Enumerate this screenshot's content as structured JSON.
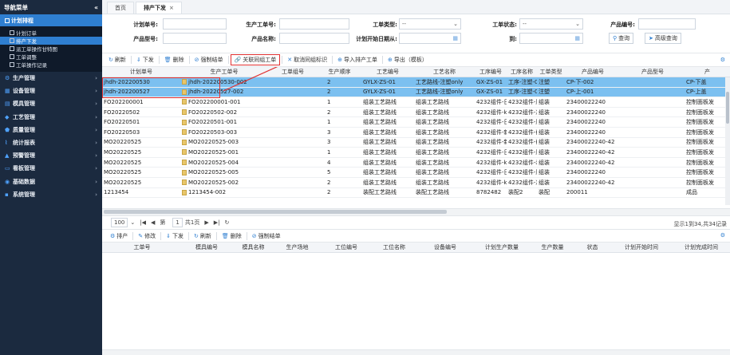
{
  "sidebar": {
    "header": "导航菜单",
    "collapse": "«",
    "active_section": "计划排程",
    "sub_items": [
      {
        "label": "计划订单",
        "active": false
      },
      {
        "label": "排产下发",
        "active": true
      },
      {
        "label": "派工单操作甘特图",
        "active": false
      },
      {
        "label": "工单调整",
        "active": false
      },
      {
        "label": "工单操作记录",
        "active": false
      }
    ],
    "sections": [
      {
        "label": "生产管理",
        "icon": "gear-icon"
      },
      {
        "label": "设备管理",
        "icon": "grid-icon"
      },
      {
        "label": "模具管理",
        "icon": "mold-icon"
      },
      {
        "label": "工艺管理",
        "icon": "flow-icon"
      },
      {
        "label": "质量管理",
        "icon": "shield-icon"
      },
      {
        "label": "统计报表",
        "icon": "chart-icon"
      },
      {
        "label": "预警管理",
        "icon": "alert-icon"
      },
      {
        "label": "看板管理",
        "icon": "board-icon"
      },
      {
        "label": "基础数据",
        "icon": "data-icon"
      },
      {
        "label": "系统管理",
        "icon": "system-icon"
      }
    ]
  },
  "tabs": [
    {
      "label": "首页"
    },
    {
      "label": "排产下发",
      "close": "×"
    }
  ],
  "filters": {
    "plan_no": "计划单号:",
    "work_no": "生产工单号:",
    "process_type": "工单类型:",
    "process_type_value": "--",
    "status": "工单状态:",
    "status_value": "--",
    "product_code": "产品编号:",
    "product_model": "产品型号:",
    "product_name": "产品名称:",
    "plan_start": "计划开始日期从:",
    "to": "到:",
    "query_btn": "查询",
    "advanced_btn": "高级查询"
  },
  "toolbar": {
    "refresh": "刷新",
    "dispatch": "下发",
    "delete": "删除",
    "force_close": "强制结单",
    "link_group": "关联同组工单",
    "unlink_group": "取消同组标识",
    "import": "导入排产工单",
    "export": "导出（模板）"
  },
  "grid": {
    "columns": [
      "计划单号",
      "生产工单号",
      "工单组号",
      "生产顺序",
      "工艺编号",
      "工艺名称",
      "工序编号",
      "工序名称",
      "工单类型",
      "产品编号",
      "产品型号",
      "产"
    ],
    "rows": [
      [
        "jhdh-202200530",
        "jhdh-202200530-002",
        "",
        "2",
        "GYLX-ZS-01",
        "工艺路线-注塑only",
        "GX-ZS-01",
        "工序-注塑-0",
        "注塑",
        "CP-下-002",
        "",
        "CP-下盖"
      ],
      [
        "jhdh-202200527",
        "jhdh-20220527-002",
        "",
        "2",
        "GYLX-ZS-01",
        "工艺路线-注塑only",
        "GX-ZS-01",
        "工序-注塑-0",
        "注塑",
        "CP-上-001",
        "",
        "CP-上盖"
      ],
      [
        "FO202200001",
        "FO202200001-001",
        "",
        "1",
        "组装工艺路线",
        "组装工艺路线",
        "4232组件-日",
        "4232组件-压",
        "组装",
        "23400022240",
        "",
        "控制面板发"
      ],
      [
        "FO20220502",
        "FO20220502-002",
        "",
        "2",
        "组装工艺路线",
        "组装工艺路线",
        "4232组件-k",
        "4232组件-减",
        "组装",
        "23400022240",
        "",
        "控制面板发"
      ],
      [
        "FO20220501",
        "FO20220501-001",
        "",
        "1",
        "组装工艺路线",
        "组装工艺路线",
        "4232组件-日",
        "4232组件-压",
        "组装",
        "23400022240",
        "",
        "控制面板发"
      ],
      [
        "FO20220503",
        "FO20220503-003",
        "",
        "3",
        "组装工艺路线",
        "组装工艺路线",
        "4232组件-新",
        "4232组件-削",
        "组装",
        "23400022240",
        "",
        "控制面板发"
      ],
      [
        "MO20220525",
        "MO20220525-003",
        "",
        "3",
        "组装工艺路线",
        "组装工艺路线",
        "4232组件-新",
        "4232组件-削",
        "组装",
        "23400022240-42",
        "",
        "控制面板发"
      ],
      [
        "MO20220525",
        "MO20220525-001",
        "",
        "1",
        "组装工艺路线",
        "组装工艺路线",
        "4232组件-日",
        "4232组件-压",
        "组装",
        "23400022240-42",
        "",
        "控制面板发"
      ],
      [
        "MO20220525",
        "MO20220525-004",
        "",
        "4",
        "组装工艺路线",
        "组装工艺路线",
        "4232组件-k",
        "4232组件-装",
        "组装",
        "23400022240-42",
        "",
        "控制面板发"
      ],
      [
        "MO20220525",
        "MO20220525-005",
        "",
        "5",
        "组装工艺路线",
        "组装工艺路线",
        "4232组件-日",
        "4232组件-压",
        "组装",
        "23400022240",
        "",
        "控制面板发"
      ],
      [
        "MO20220525",
        "MO20220525-002",
        "",
        "2",
        "组装工艺路线",
        "组装工艺路线",
        "4232组件-k",
        "4232组件-减",
        "组装",
        "23400022240-42",
        "",
        "控制面板发"
      ],
      [
        "1213454",
        "1213454-002",
        "",
        "2",
        "装配工艺路线",
        "装配工艺路线",
        "8782482",
        "装配2",
        "装配",
        "200011",
        "",
        "成品"
      ]
    ]
  },
  "pager": {
    "page_size": "100",
    "page_prefix": "第",
    "page_no": "1",
    "page_total": "共1页",
    "refresh_icon": "↻",
    "info": "显示1到34,共34记录"
  },
  "toolbar2": {
    "schedule": "排产",
    "edit": "修改",
    "dispatch": "下发",
    "refresh": "刷新",
    "delete": "删除",
    "force_close": "强制结单"
  },
  "grid2": {
    "columns": [
      "工单号",
      "模具编号",
      "模具名称",
      "生产场地",
      "工位编号",
      "工位名称",
      "设备编号",
      "计划生产数量",
      "生产数量",
      "状态",
      "计划开始时间",
      "计划完成时间"
    ]
  }
}
